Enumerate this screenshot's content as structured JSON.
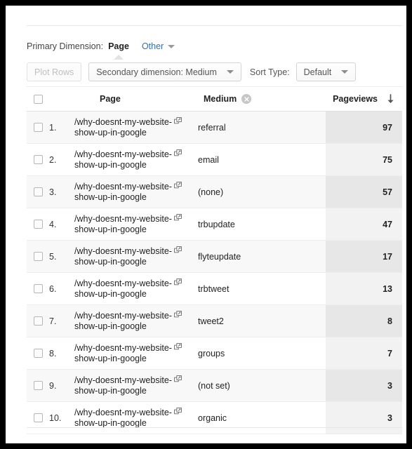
{
  "dimension_bar": {
    "label": "Primary Dimension:",
    "active": "Page",
    "other": "Other"
  },
  "controls": {
    "plot_rows": "Plot Rows",
    "secondary_dimension": "Secondary dimension: Medium",
    "sort_type_label": "Sort Type:",
    "sort_type_value": "Default"
  },
  "table": {
    "headers": {
      "page": "Page",
      "medium": "Medium",
      "pageviews": "Pageviews"
    },
    "icons": {
      "remove_dimension": "close-circle-icon",
      "sort_descending": "arrow-down-icon",
      "open_in_new": "external-link-icon"
    },
    "rows": [
      {
        "index": "1.",
        "page_line1": "/why-doesnt-my-website-",
        "page_line2": "show-up-in-google",
        "medium": "referral",
        "pageviews": "97"
      },
      {
        "index": "2.",
        "page_line1": "/why-doesnt-my-website-",
        "page_line2": "show-up-in-google",
        "medium": "email",
        "pageviews": "75"
      },
      {
        "index": "3.",
        "page_line1": "/why-doesnt-my-website-",
        "page_line2": "show-up-in-google",
        "medium": "(none)",
        "pageviews": "57"
      },
      {
        "index": "4.",
        "page_line1": "/why-doesnt-my-website-",
        "page_line2": "show-up-in-google",
        "medium": "trbupdate",
        "pageviews": "47"
      },
      {
        "index": "5.",
        "page_line1": "/why-doesnt-my-website-",
        "page_line2": "show-up-in-google",
        "medium": "flyteupdate",
        "pageviews": "17"
      },
      {
        "index": "6.",
        "page_line1": "/why-doesnt-my-website-",
        "page_line2": "show-up-in-google",
        "medium": "trbtweet",
        "pageviews": "13"
      },
      {
        "index": "7.",
        "page_line1": "/why-doesnt-my-website-",
        "page_line2": "show-up-in-google",
        "medium": "tweet2",
        "pageviews": "8"
      },
      {
        "index": "8.",
        "page_line1": "/why-doesnt-my-website-",
        "page_line2": "show-up-in-google",
        "medium": "groups",
        "pageviews": "7"
      },
      {
        "index": "9.",
        "page_line1": "/why-doesnt-my-website-",
        "page_line2": "show-up-in-google",
        "medium": "(not set)",
        "pageviews": "3"
      },
      {
        "index": "10.",
        "page_line1": "/why-doesnt-my-website-",
        "page_line2": "show-up-in-google",
        "medium": "organic",
        "pageviews": "3"
      }
    ]
  },
  "colors": {
    "link": "#2f70c4",
    "column_highlight": "#f2f2f2",
    "frame": "#000000"
  }
}
